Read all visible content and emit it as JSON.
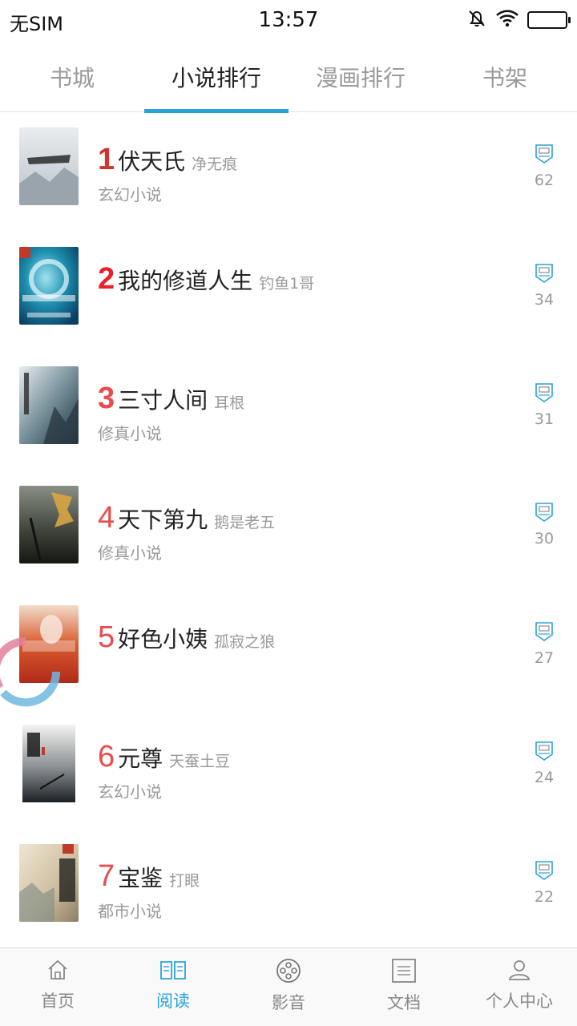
{
  "status_bar": {
    "carrier": "无SIM",
    "time": "13:57",
    "battery_level": 1.0
  },
  "tabs": [
    {
      "label": "书城",
      "active": false
    },
    {
      "label": "小说排行",
      "active": true
    },
    {
      "label": "漫画排行",
      "active": false
    },
    {
      "label": "书架",
      "active": false
    }
  ],
  "ranking": [
    {
      "rank": "1",
      "title": "伏天氏",
      "author": "净无痕",
      "genre": "玄幻小说",
      "votes": "62"
    },
    {
      "rank": "2",
      "title": "我的修道人生",
      "author": "钓鱼1哥",
      "genre": "",
      "votes": "34"
    },
    {
      "rank": "3",
      "title": "三寸人间",
      "author": "耳根",
      "genre": "修真小说",
      "votes": "31"
    },
    {
      "rank": "4",
      "title": "天下第九",
      "author": "鹅是老五",
      "genre": "修真小说",
      "votes": "30"
    },
    {
      "rank": "5",
      "title": "好色小姨",
      "author": "孤寂之狼",
      "genre": "",
      "votes": "27"
    },
    {
      "rank": "6",
      "title": "元尊",
      "author": "天蚕土豆",
      "genre": "玄幻小说",
      "votes": "24"
    },
    {
      "rank": "7",
      "title": "宝鉴",
      "author": "打眼",
      "genre": "都市小说",
      "votes": "22"
    }
  ],
  "bottom_nav": [
    {
      "label": "首页",
      "icon": "home-icon",
      "active": false
    },
    {
      "label": "阅读",
      "icon": "book-icon",
      "active": true
    },
    {
      "label": "影音",
      "icon": "film-reel-icon",
      "active": false
    },
    {
      "label": "文档",
      "icon": "document-icon",
      "active": false
    },
    {
      "label": "个人中心",
      "icon": "user-icon",
      "active": false
    }
  ],
  "colors": {
    "accent": "#29a3dc",
    "rank_top": "#d0342c",
    "rank_other": "#e84d4d",
    "muted_text": "#9a9a9a"
  }
}
